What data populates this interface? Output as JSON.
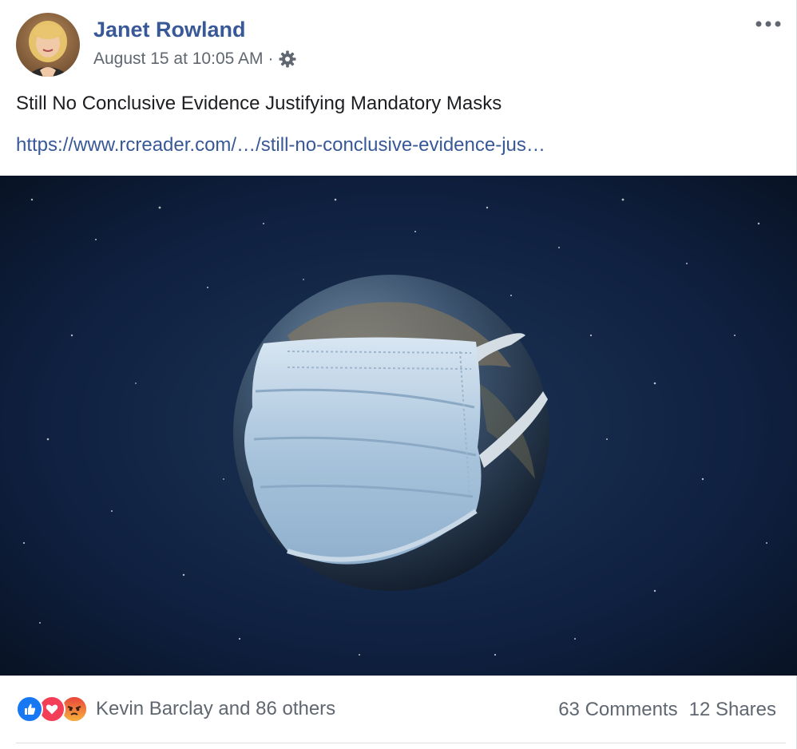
{
  "post": {
    "author": "Janet Rowland",
    "timestamp": "August 15 at 10:05 AM",
    "separator": "·",
    "privacy_icon": "gear-icon",
    "menu_icon": "more-options-icon",
    "text": "Still No Conclusive Evidence Justifying Mandatory Masks",
    "link": "https://www.rcreader.com/…/still-no-conclusive-evidence-jus…"
  },
  "image": {
    "subject": "earth-wearing-mask"
  },
  "footer": {
    "reaction_icons": [
      "like-icon",
      "love-icon",
      "angry-icon"
    ],
    "reactions_text": "Kevin Barclay and 86 others",
    "comments": "63 Comments",
    "shares": "12 Shares"
  },
  "colors": {
    "author_link": "#385898",
    "meta_text": "#606770",
    "like": "#1877f2",
    "love": "#f33e58",
    "angry": "#f7714c"
  }
}
